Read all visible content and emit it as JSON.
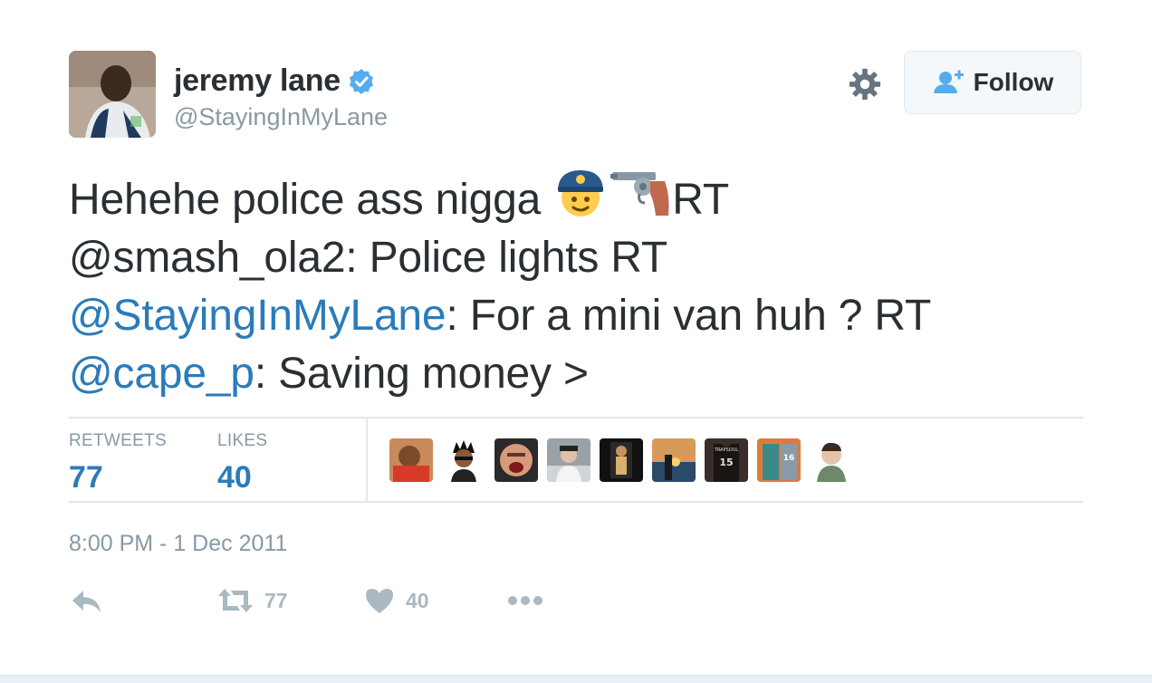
{
  "author": {
    "name": "jeremy lane",
    "handle": "@StayingInMyLane",
    "verified": true
  },
  "follow_button": {
    "label": "Follow"
  },
  "tweet": {
    "line1": "Hehehe police ass nigga ",
    "line1_emojis": [
      "police-officer",
      "pistol"
    ],
    "line1_end": "RT",
    "line2": "@smash_ola2: Police lights RT",
    "line3_mention": "@StayingInMyLane",
    "line3_rest": ": For a mini van huh ? RT",
    "line4_mention": "@cape_p",
    "line4_rest": ": Saving money >"
  },
  "stats": {
    "retweets_label": "RETWEETS",
    "retweets_value": "77",
    "likes_label": "LIKES",
    "likes_value": "40"
  },
  "likers": [
    {
      "icon": "liker-avatar-1"
    },
    {
      "icon": "liker-avatar-2"
    },
    {
      "icon": "liker-avatar-3"
    },
    {
      "icon": "liker-avatar-4"
    },
    {
      "icon": "liker-avatar-5"
    },
    {
      "icon": "liker-avatar-6"
    },
    {
      "icon": "liker-avatar-7",
      "text": "15"
    },
    {
      "icon": "liker-avatar-8",
      "text": "16"
    },
    {
      "icon": "liker-avatar-9"
    }
  ],
  "timestamp": "8:00 PM - 1 Dec 2011",
  "actions": {
    "retweet_count": "77",
    "like_count": "40"
  },
  "colors": {
    "accent": "#2b7bb9",
    "muted": "#8899a6",
    "text": "#292f33",
    "verified": "#55acee"
  }
}
